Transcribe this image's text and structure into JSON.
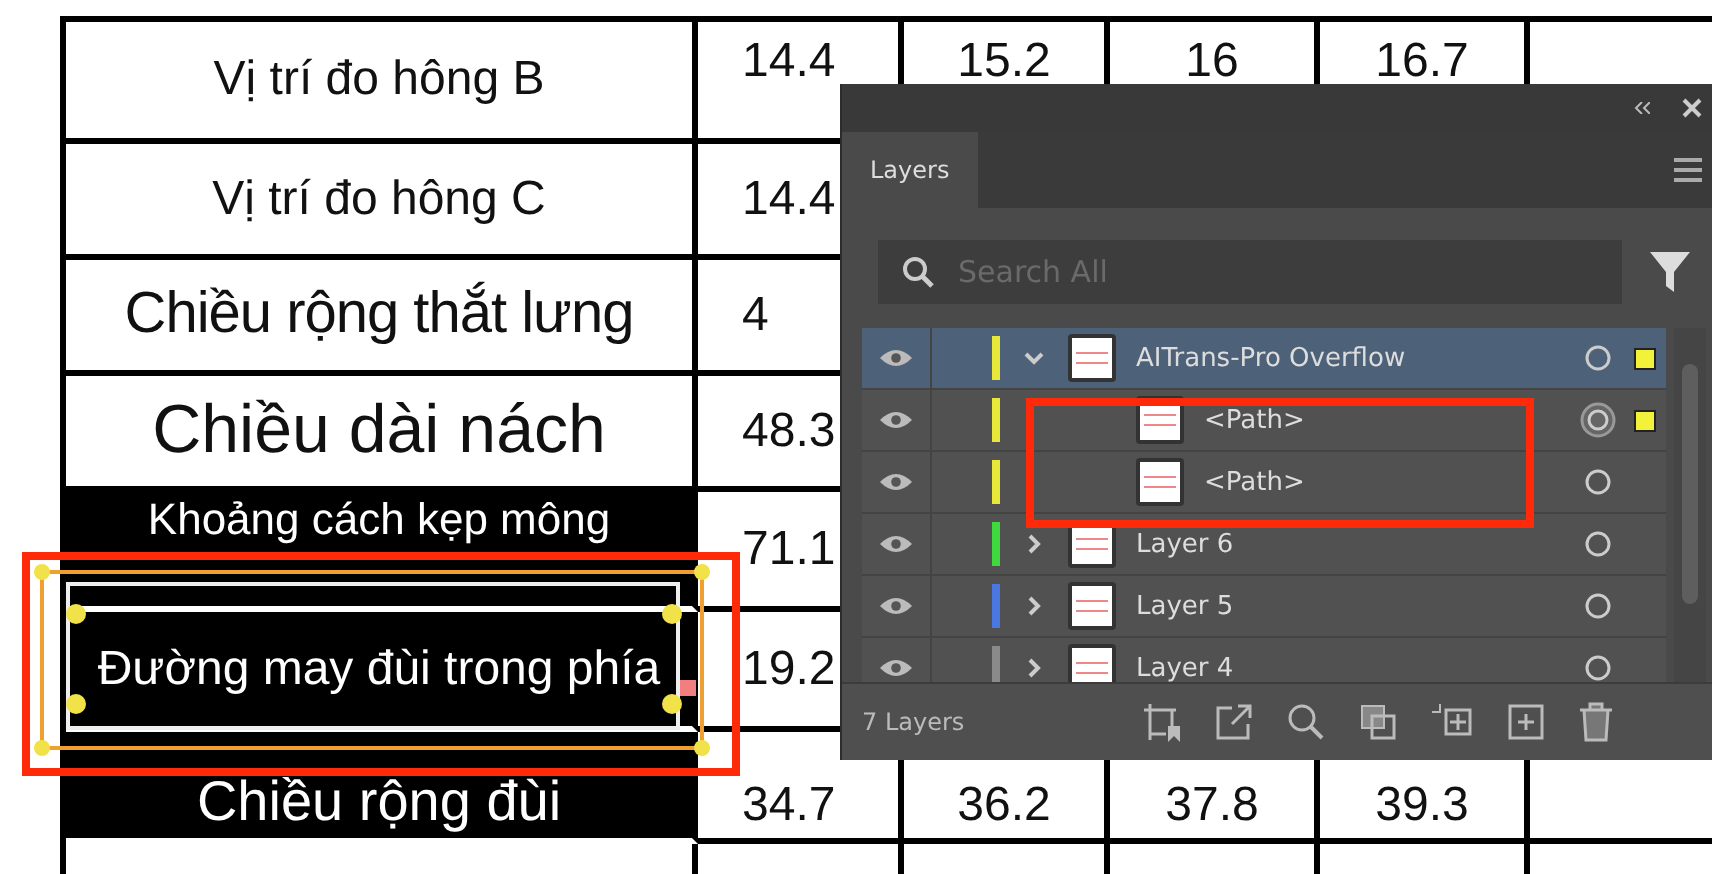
{
  "table": {
    "rows": [
      {
        "dark": false,
        "cells": [
          "Vị trí đo hông B",
          "14.4",
          "15.2",
          "16",
          "16.7",
          ""
        ]
      },
      {
        "dark": false,
        "cells": [
          "Vị trí đo hông C",
          "14.4",
          "",
          "",
          "",
          ""
        ]
      },
      {
        "dark": false,
        "cells": [
          "Chiều rộng thắt lưng",
          "4",
          "",
          "",
          "",
          ""
        ]
      },
      {
        "dark": false,
        "cells": [
          "Chiều dài nách",
          "48.3",
          "",
          "",
          "",
          ""
        ]
      },
      {
        "dark": true,
        "cells": [
          "Khoảng cách kẹp mông",
          "71.1",
          "",
          "",
          "",
          ""
        ]
      },
      {
        "dark": true,
        "cells": [
          "Đường may đùi trong phía",
          "19.2",
          "",
          "",
          "",
          ""
        ]
      },
      {
        "dark": true,
        "cells": [
          "Chiều rộng đùi",
          "34.7",
          "36.2",
          "37.8",
          "39.3",
          ""
        ]
      }
    ]
  },
  "layers_panel": {
    "tabs": [
      {
        "label": "Layers",
        "selected": true
      }
    ],
    "search": {
      "placeholder": "Search All"
    },
    "layers": [
      {
        "name": "AITrans-Pro Overflow",
        "color": "#e8e83a",
        "visible": true,
        "expanded": true,
        "selected": true,
        "targeted": false,
        "has_selection": true,
        "children": [
          {
            "name": "<Path>",
            "visible": true,
            "selected": false,
            "targeted": true,
            "has_selection": true
          },
          {
            "name": "<Path>",
            "visible": true,
            "selected": false,
            "targeted": false,
            "has_selection": false
          }
        ]
      },
      {
        "name": "Layer 6",
        "color": "#3fd83f",
        "visible": true,
        "expanded": false,
        "selected": false,
        "targeted": false,
        "has_selection": false
      },
      {
        "name": "Layer 5",
        "color": "#4a78e0",
        "visible": true,
        "expanded": false,
        "selected": false,
        "targeted": false,
        "has_selection": false
      },
      {
        "name": "Layer 4",
        "color": "#8a8a8a",
        "visible": true,
        "expanded": false,
        "selected": false,
        "targeted": false,
        "has_selection": false
      }
    ],
    "status": "7 Layers"
  }
}
